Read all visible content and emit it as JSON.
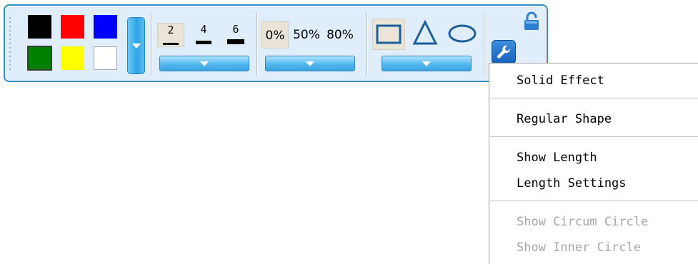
{
  "toolbar": {
    "colors": [
      "#000000",
      "#ff0000",
      "#0000ff",
      "#008000",
      "#ffff00",
      "#ffffff"
    ],
    "selected_color": "#008000",
    "line_widths": [
      "2",
      "4",
      "6"
    ],
    "selected_width": "2",
    "transparency": [
      "0%",
      "50%",
      "80%"
    ],
    "selected_transparency": "0%",
    "shapes": [
      "rectangle",
      "triangle",
      "ellipse"
    ],
    "selected_shape": "rectangle",
    "icons": {
      "grip": "grip-dots-icon",
      "dropdown": "dropdown-arrow-icon",
      "tools": "wrench-icon",
      "lock": "lock-icon"
    },
    "accent": "#2d8fc8"
  },
  "menu": {
    "items": [
      {
        "label": "Solid Effect",
        "enabled": true
      },
      {
        "label": "Regular Shape",
        "enabled": true
      },
      {
        "label": "Show Length",
        "enabled": true
      },
      {
        "label": "Length Settings",
        "enabled": true
      },
      {
        "label": "Show Circum Circle",
        "enabled": false
      },
      {
        "label": "Show Inner Circle",
        "enabled": false
      }
    ]
  }
}
